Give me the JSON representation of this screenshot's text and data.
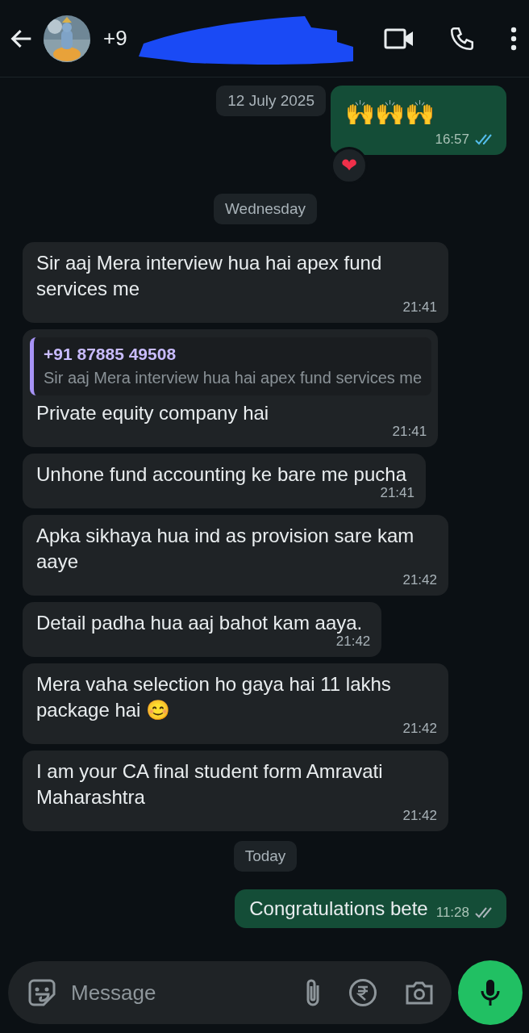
{
  "header": {
    "title": "+9"
  },
  "messages": [
    {
      "kind": "date",
      "text": "12 July 2025"
    },
    {
      "kind": "out",
      "text": "🙌🙌🙌",
      "time": "16:57",
      "read": true,
      "reaction": "❤"
    },
    {
      "kind": "date",
      "text": "Wednesday"
    },
    {
      "kind": "in",
      "text": "Sir aaj Mera interview hua hai apex fund services me",
      "time": "21:41"
    },
    {
      "kind": "in",
      "quote": {
        "sender": "+91 87885 49508",
        "text": "Sir aaj Mera interview hua hai apex fund services me"
      },
      "text": "Private equity company hai",
      "time": "21:41"
    },
    {
      "kind": "in",
      "text": "Unhone fund accounting ke bare me pucha",
      "time": "21:41"
    },
    {
      "kind": "in",
      "text": "Apka sikhaya hua ind as provision sare kam aaye",
      "time": "21:42"
    },
    {
      "kind": "in",
      "text": "Detail padha hua aaj bahot kam aaya.",
      "time": "21:42"
    },
    {
      "kind": "in",
      "text": "Mera vaha selection ho gaya hai 11 lakhs package hai 😊",
      "time": "21:42"
    },
    {
      "kind": "in",
      "text": "I am your CA final student form Amravati Maharashtra",
      "time": "21:42"
    },
    {
      "kind": "date",
      "text": "Today"
    },
    {
      "kind": "out",
      "text": "Congratulations bete",
      "time": "11:28",
      "read": false
    }
  ],
  "composer": {
    "placeholder": "Message"
  }
}
